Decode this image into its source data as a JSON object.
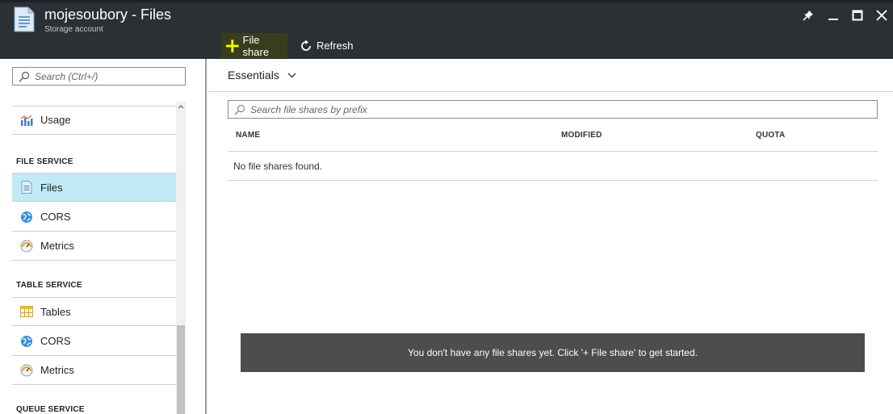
{
  "header": {
    "title": "mojesoubory - Files",
    "subtitle": "Storage account",
    "toolbar": {
      "add_label": "File share",
      "refresh_label": "Refresh"
    }
  },
  "colors": {
    "header_bg": "#2b3035",
    "selected_bg": "#bfeaf6",
    "add_icon": "#f5f500",
    "banner_bg": "#4d4d4d"
  },
  "sidebar": {
    "search_placeholder": "Search (Ctrl+/)",
    "items": [
      {
        "label": "Usage",
        "icon": "usage-icon"
      }
    ],
    "sections": [
      {
        "title": "FILE SERVICE",
        "items": [
          {
            "label": "Files",
            "icon": "files-icon",
            "selected": true
          },
          {
            "label": "CORS",
            "icon": "cors-icon"
          },
          {
            "label": "Metrics",
            "icon": "metrics-icon"
          }
        ]
      },
      {
        "title": "TABLE SERVICE",
        "items": [
          {
            "label": "Tables",
            "icon": "tables-icon"
          },
          {
            "label": "CORS",
            "icon": "cors-icon"
          },
          {
            "label": "Metrics",
            "icon": "metrics-icon"
          }
        ]
      },
      {
        "title": "QUEUE SERVICE",
        "items": []
      }
    ]
  },
  "main": {
    "essentials_label": "Essentials",
    "search_placeholder": "Search file shares by prefix",
    "table": {
      "columns": [
        "NAME",
        "MODIFIED",
        "QUOTA"
      ],
      "empty_text": "No file shares found."
    },
    "empty_banner": "You don't have any file shares yet. Click '+ File share' to get started."
  }
}
